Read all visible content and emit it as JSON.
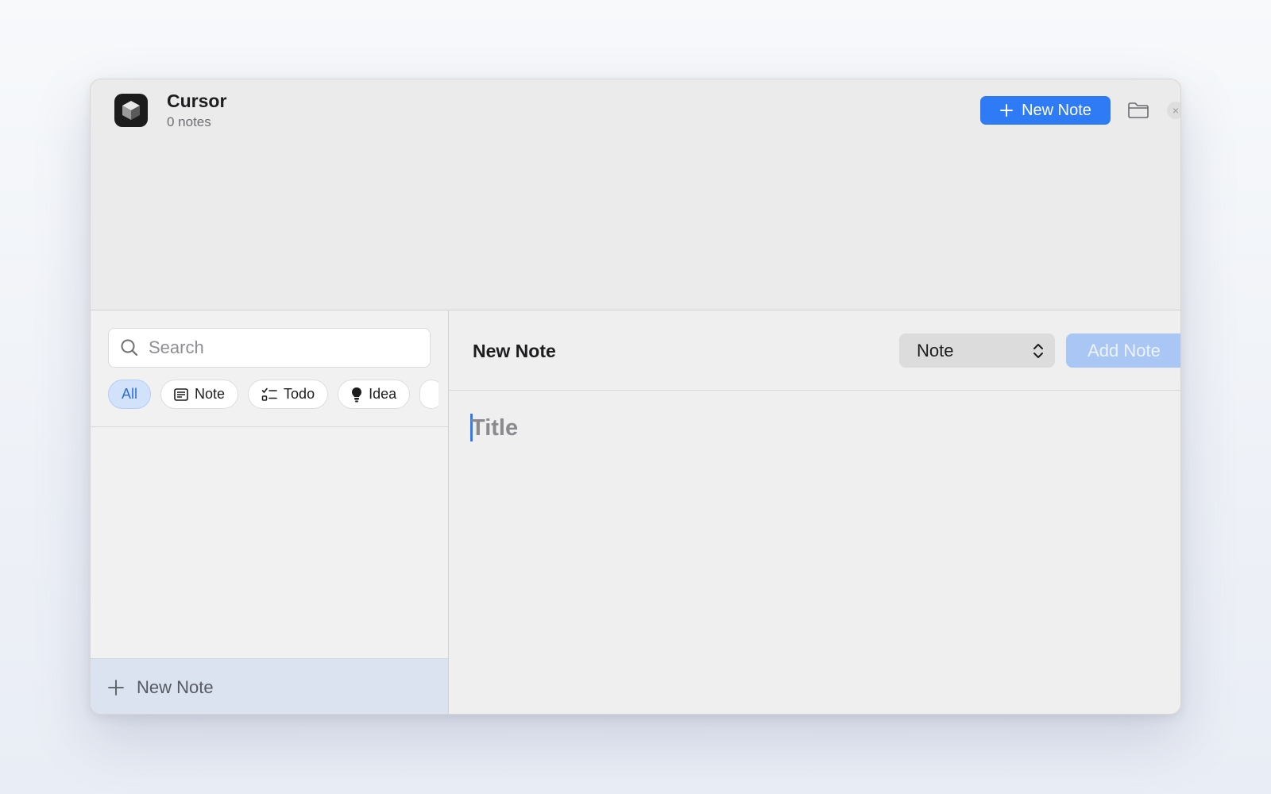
{
  "header": {
    "app_title": "Cursor",
    "note_count": "0 notes",
    "new_note_label": "New Note",
    "close_glyph": "×"
  },
  "sidebar": {
    "search_placeholder": "Search",
    "filters": [
      {
        "label": "All",
        "icon": "",
        "active": true
      },
      {
        "label": "Note",
        "icon": "note-icon",
        "active": false
      },
      {
        "label": "Todo",
        "icon": "checklist-icon",
        "active": false
      },
      {
        "label": "Idea",
        "icon": "lightbulb-icon",
        "active": false
      }
    ],
    "footer_label": "New Note"
  },
  "editor": {
    "heading": "New Note",
    "type_value": "Note",
    "add_label": "Add Note",
    "title_placeholder": "Title"
  },
  "colors": {
    "accent": "#2f7bf6",
    "accent_disabled": "#a9c6f5",
    "chip_active_bg": "#d3e2fb",
    "footer_bg": "#dce3f0"
  }
}
